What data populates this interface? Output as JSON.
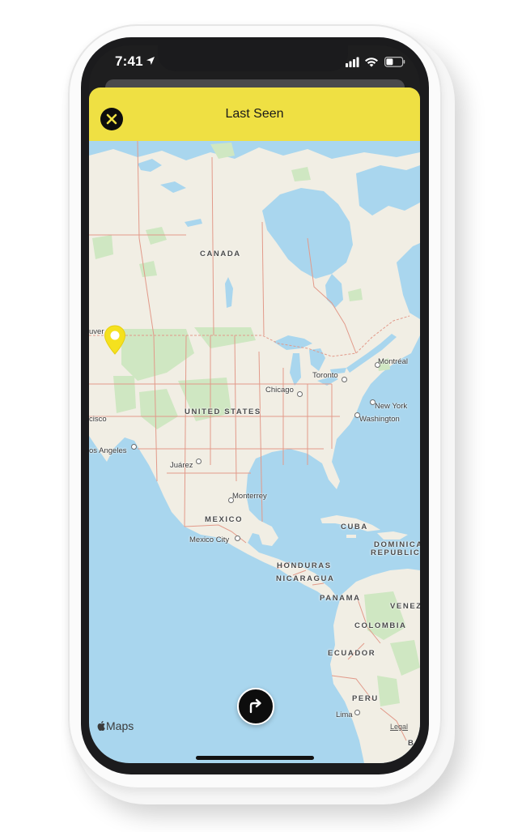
{
  "status_bar": {
    "time": "7:41",
    "location_icon": "location-arrow-icon",
    "signal_icon": "cellular-signal-icon",
    "wifi_icon": "wifi-icon",
    "battery_icon": "battery-icon"
  },
  "header": {
    "title": "Last Seen",
    "close_icon": "close-icon",
    "background_color": "#efe043"
  },
  "map": {
    "countries": [
      "CANADA",
      "UNITED STATES",
      "MEXICO",
      "CUBA",
      "DOMINICAN",
      "REPUBLIC",
      "HONDURAS",
      "NICARAGUA",
      "PANAMA",
      "VENEZ",
      "COLOMBIA",
      "ECUADOR",
      "PERU",
      "BO"
    ],
    "cities": [
      "Toronto",
      "Montréal",
      "Chicago",
      "New York",
      "Washington",
      "uver",
      "cisco",
      "os Angeles",
      "Juárez",
      "Monterrey",
      "Mexico City",
      "Lima"
    ],
    "pin_icon": "location-pin-icon",
    "pin_color": "#f5e11e",
    "logo_text": "Maps",
    "legal_text": "Legal"
  },
  "route_button": {
    "icon": "directions-arrow-icon"
  },
  "colors": {
    "water": "#a9d6ee",
    "land": "#f1eee4",
    "park": "#cfe7c2",
    "border": "#e29a8a"
  }
}
